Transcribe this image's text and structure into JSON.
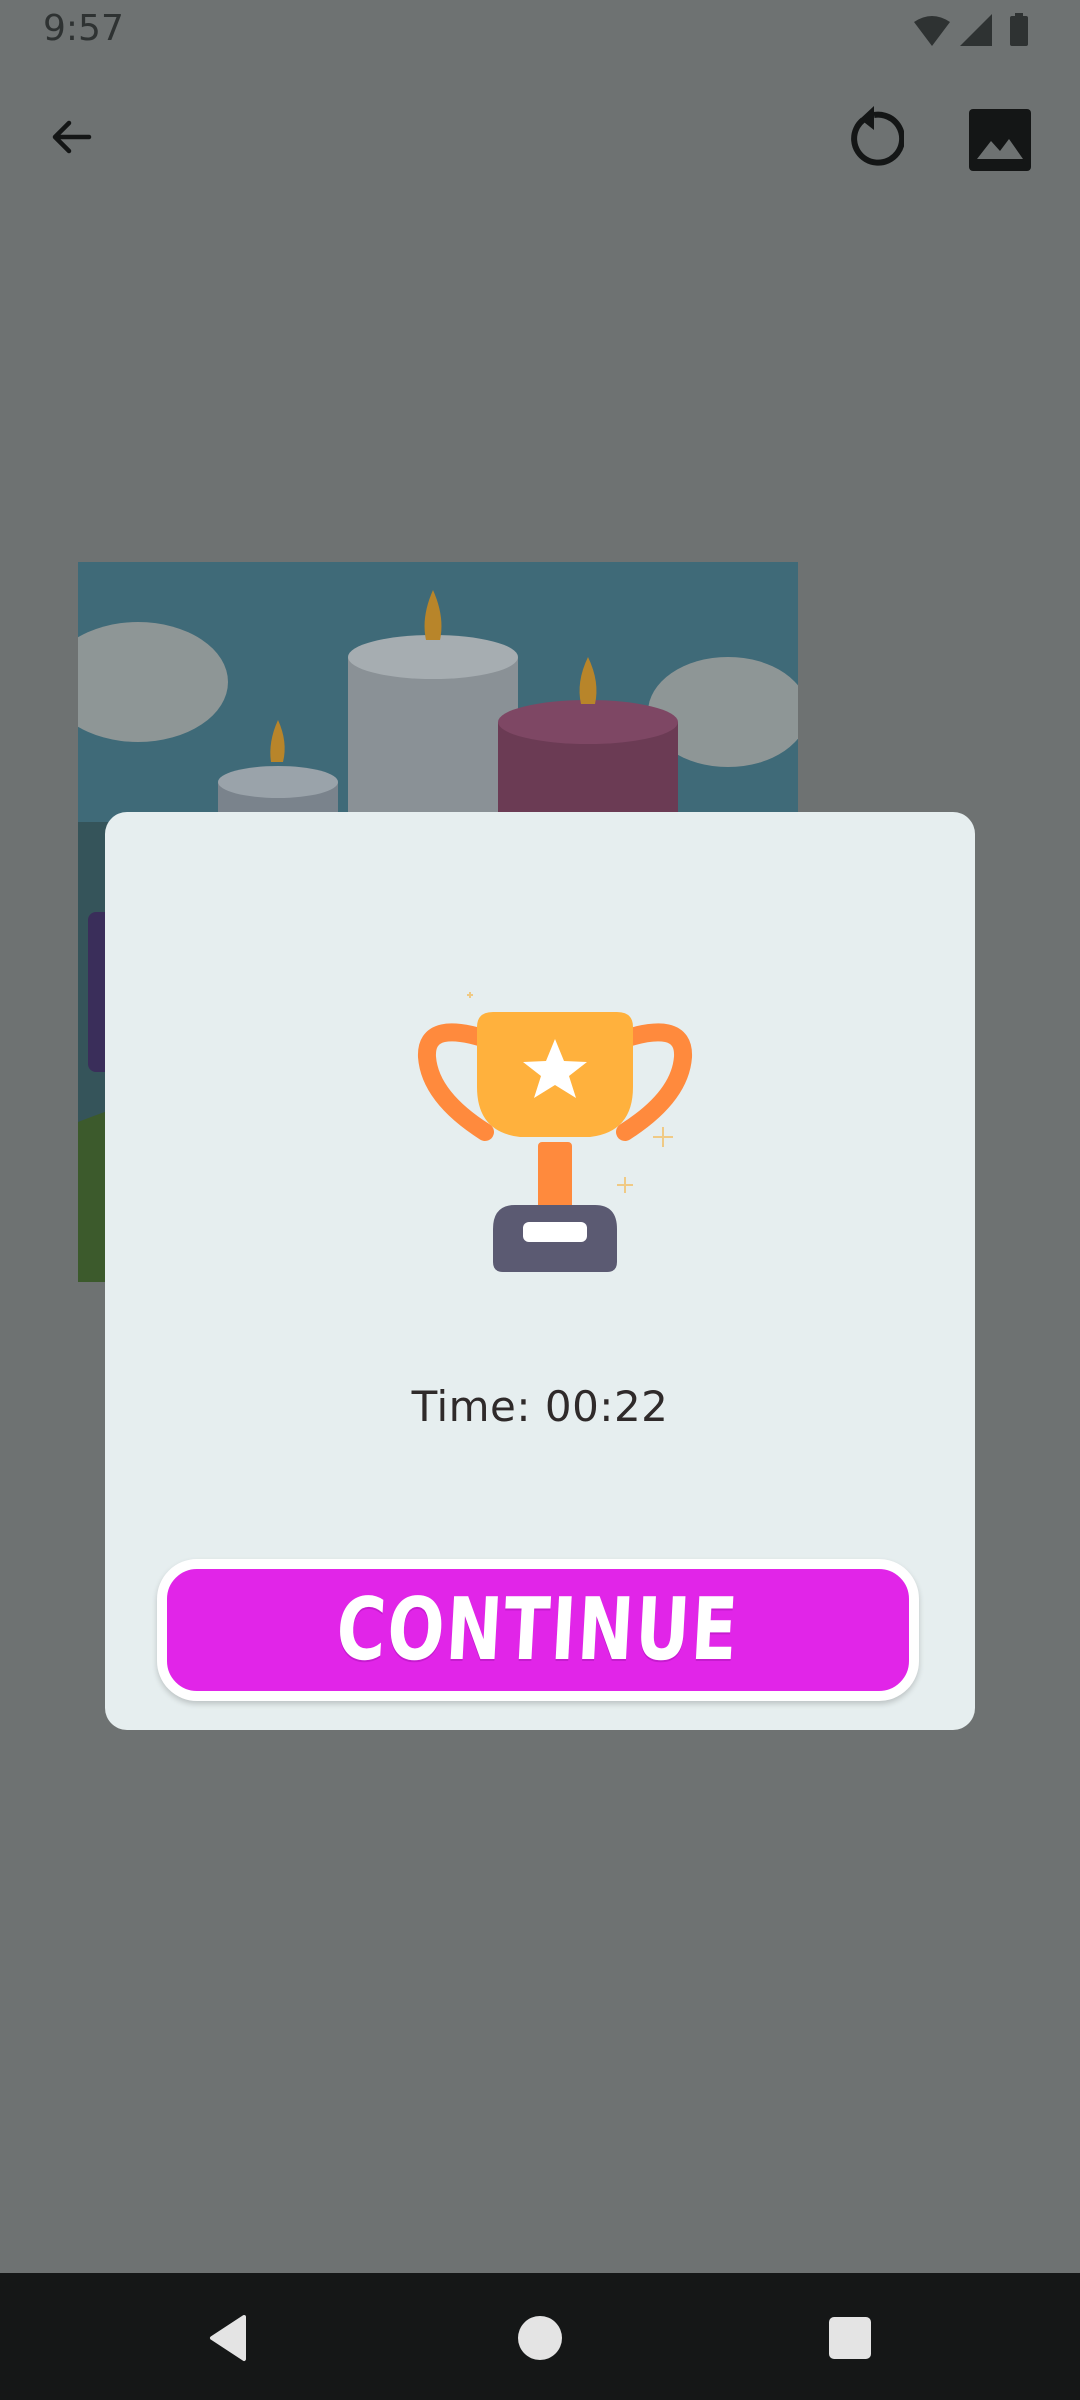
{
  "status_bar": {
    "time": "9:57",
    "icons": [
      "wifi-icon",
      "cellular-signal-icon",
      "battery-icon"
    ]
  },
  "app_bar": {
    "icons": [
      "back-arrow-icon",
      "restart-icon",
      "image-icon"
    ]
  },
  "puzzle": {
    "scene": "candles-illustration"
  },
  "dialog": {
    "icon": "trophy-icon",
    "time_text": "Time: 00:22",
    "continue_label": "CONTINUE"
  },
  "colors": {
    "scrim": "#6e7272",
    "dialog_bg": "#e6eeef",
    "button_bg": "#e125e8",
    "button_border": "#ffffff",
    "trophy_cup": "#ffb13d",
    "trophy_handles": "#ff8a3d",
    "trophy_base": "#5b5a72",
    "nav_bar": "#151717"
  },
  "nav_bar": {
    "icons": [
      "nav-back-icon",
      "nav-home-icon",
      "nav-recents-icon"
    ]
  }
}
